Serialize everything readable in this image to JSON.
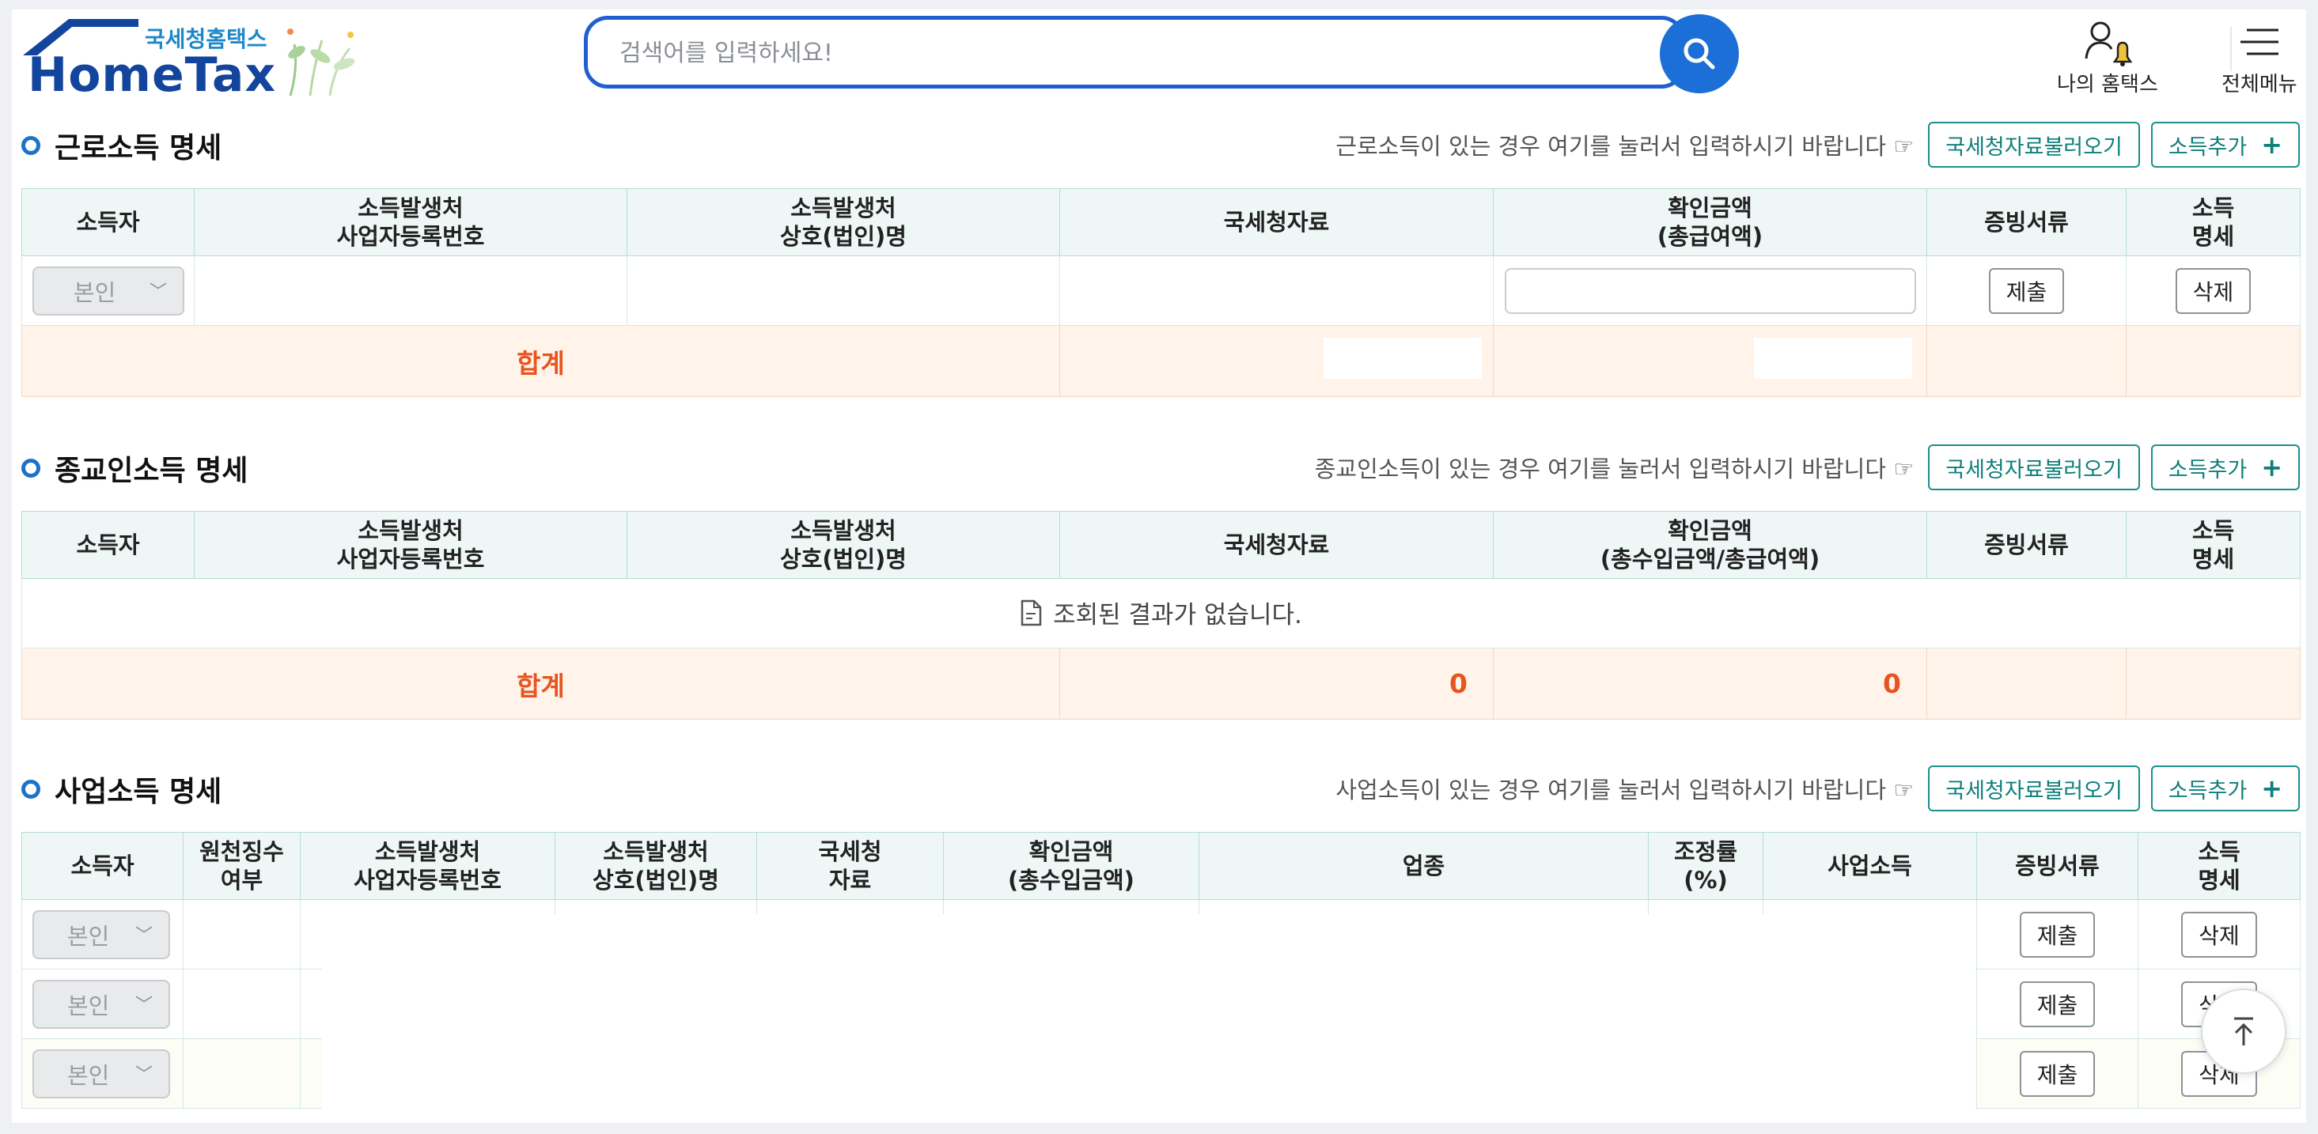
{
  "header": {
    "logo_sub": "국세청홈택스",
    "logo_main": "HomeTax",
    "search_placeholder": "검색어를 입력하세요!",
    "my_hometax": "나의 홈택스",
    "all_menu": "전체메뉴"
  },
  "sections": {
    "earned": {
      "title": "근로소득 명세",
      "hint": "근로소득이 있는 경우 여기를 눌러서 입력하시기 바랍니다 ☞",
      "btn_load": "국세청자료불러오기",
      "btn_add": "소득추가",
      "columns": [
        "소득자",
        "소득발생처\n사업자등록번호",
        "소득발생처\n상호(법인)명",
        "국세청자료",
        "확인금액\n(총급여액)",
        "증빙서류",
        "소득\n명세"
      ],
      "row": {
        "earner": "본인",
        "submit": "제출",
        "delete": "삭제"
      },
      "total_label": "합계"
    },
    "religious": {
      "title": "종교인소득 명세",
      "hint": "종교인소득이 있는 경우 여기를 눌러서 입력하시기 바랍니다 ☞",
      "btn_load": "국세청자료불러오기",
      "btn_add": "소득추가",
      "columns": [
        "소득자",
        "소득발생처\n사업자등록번호",
        "소득발생처\n상호(법인)명",
        "국세청자료",
        "확인금액\n(총수입금액/총급여액)",
        "증빙서류",
        "소득\n명세"
      ],
      "empty_msg": "조회된 결과가 없습니다.",
      "total_label": "합계",
      "total_nts": "0",
      "total_confirm": "0"
    },
    "business": {
      "title": "사업소득 명세",
      "hint": "사업소득이 있는 경우 여기를 눌러서 입력하시기 바랍니다 ☞",
      "btn_load": "국세청자료불러오기",
      "btn_add": "소득추가",
      "columns": [
        "소득자",
        "원천징수\n여부",
        "소득발생처\n사업자등록번호",
        "소득발생처\n상호(법인)명",
        "국세청\n자료",
        "확인금액\n(총수입금액)",
        "업종",
        "조정률\n(%)",
        "사업소득",
        "증빙서류",
        "소득\n명세"
      ],
      "rows": [
        {
          "earner": "본인",
          "submit": "제출",
          "delete": "삭제"
        },
        {
          "earner": "본인",
          "submit": "제출",
          "delete": "삭제"
        },
        {
          "earner": "본인",
          "submit": "제출",
          "delete": "삭제"
        }
      ]
    }
  },
  "colors": {
    "accent": "#1c6fd6",
    "teal": "#0e7f7a",
    "total": "#e8541e",
    "header_bg": "#eef7f6"
  }
}
